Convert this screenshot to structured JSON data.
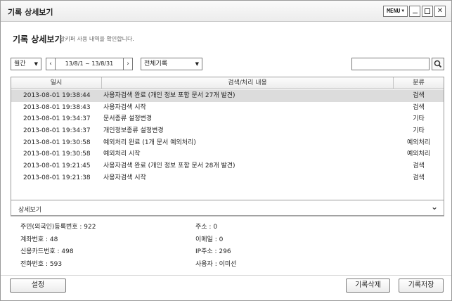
{
  "window": {
    "title": "기록 상세보기",
    "menu_label": "MENU"
  },
  "header": {
    "title": "기록 상세보기",
    "subtitle": "알키퍼 사용 내역을 확인합니다."
  },
  "toolbar": {
    "period_selected": "월간",
    "date_range": "13/8/1 ~ 13/8/31",
    "category_selected": "전체기록",
    "search_value": ""
  },
  "table": {
    "columns": [
      "일시",
      "검색/처리 내용",
      "분류"
    ],
    "rows": [
      {
        "date": "2013-08-01 19:38:44",
        "content": "사용자검색 완료 (개인 정보 포함 문서 27개 발견)",
        "category": "검색"
      },
      {
        "date": "2013-08-01 19:38:43",
        "content": "사용자검색 시작",
        "category": "검색"
      },
      {
        "date": "2013-08-01 19:34:37",
        "content": "문서종류 설정변경",
        "category": "기타"
      },
      {
        "date": "2013-08-01 19:34:37",
        "content": "개인정보종류 설정변경",
        "category": "기타"
      },
      {
        "date": "2013-08-01 19:30:58",
        "content": "예외처리 완료 (1개 문서 예외처리)",
        "category": "예외처리"
      },
      {
        "date": "2013-08-01 19:30:58",
        "content": "예외처리 시작",
        "category": "예외처리"
      },
      {
        "date": "2013-08-01 19:21:45",
        "content": "사용자검색 완료 (개인 정보 포함 문서 28개 발견)",
        "category": "검색"
      },
      {
        "date": "2013-08-01 19:21:38",
        "content": "사용자검색 시작",
        "category": "검색"
      }
    ]
  },
  "detail": {
    "title": "상세보기",
    "fields": {
      "resident_id": "주민(외국인)등록번호 : 922",
      "address": "주소 : 0",
      "account": "계좌번호 : 48",
      "email": "이메일 : 0",
      "credit_card": "신용카드번호 : 498",
      "ip": "IP주소 : 296",
      "phone": "전화번호 : 593",
      "user": "사용자 : 이미선"
    }
  },
  "footer": {
    "settings_label": "설정",
    "delete_label": "기록삭제",
    "save_label": "기록저장"
  }
}
